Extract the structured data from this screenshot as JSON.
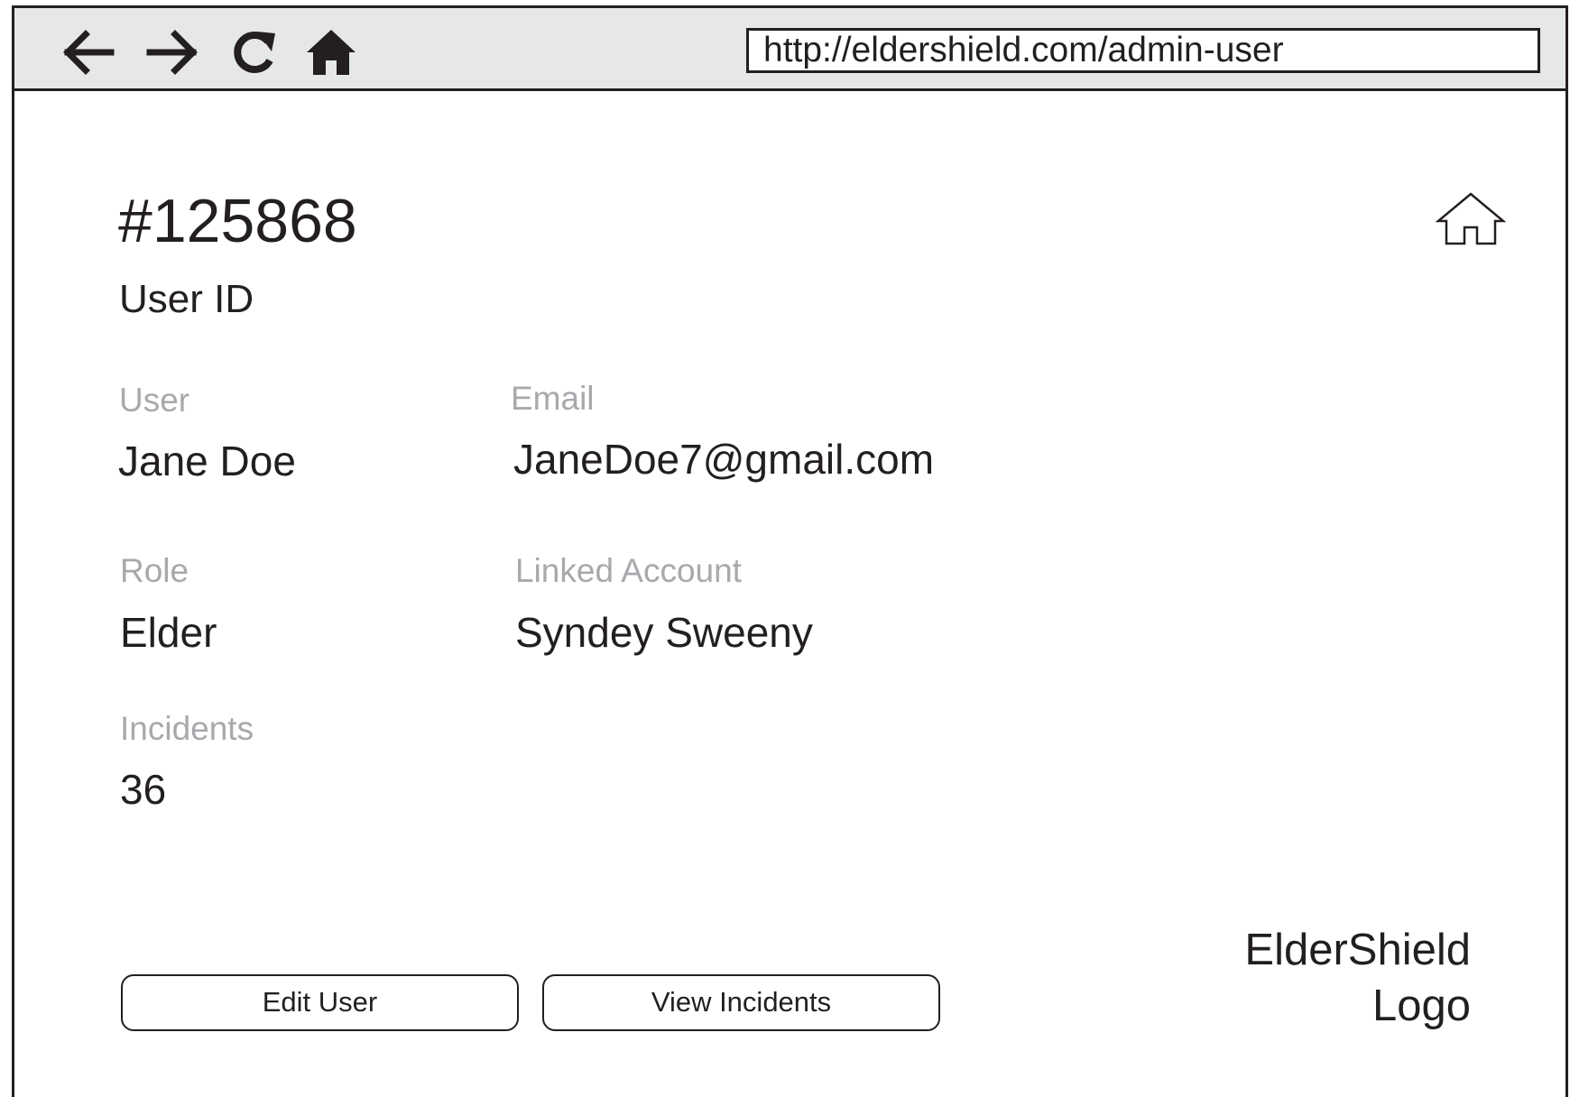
{
  "browser": {
    "back_icon": "arrow-left-icon",
    "forward_icon": "arrow-right-icon",
    "reload_icon": "reload-icon",
    "home_icon": "home-filled-icon",
    "url": "http://eldershield.com/admin-user"
  },
  "header": {
    "user_id_value": "#125868",
    "user_id_label": "User ID",
    "home_icon": "home-outline-icon"
  },
  "fields": {
    "user": {
      "label": "User",
      "value": "Jane Doe"
    },
    "email": {
      "label": "Email",
      "value": "JaneDoe7@gmail.com"
    },
    "role": {
      "label": "Role",
      "value": "Elder"
    },
    "linked_account": {
      "label": "Linked Account",
      "value": "Syndey Sweeny"
    },
    "incidents": {
      "label": "Incidents",
      "value": "36"
    }
  },
  "actions": {
    "edit_user_label": "Edit User",
    "view_incidents_label": "View Incidents"
  },
  "logo": {
    "line1": "ElderShield",
    "line2": "Logo"
  },
  "colors": {
    "text": "#231f20",
    "label_gray": "#a7a9ac",
    "toolbar_bg": "#e6e7e8"
  }
}
